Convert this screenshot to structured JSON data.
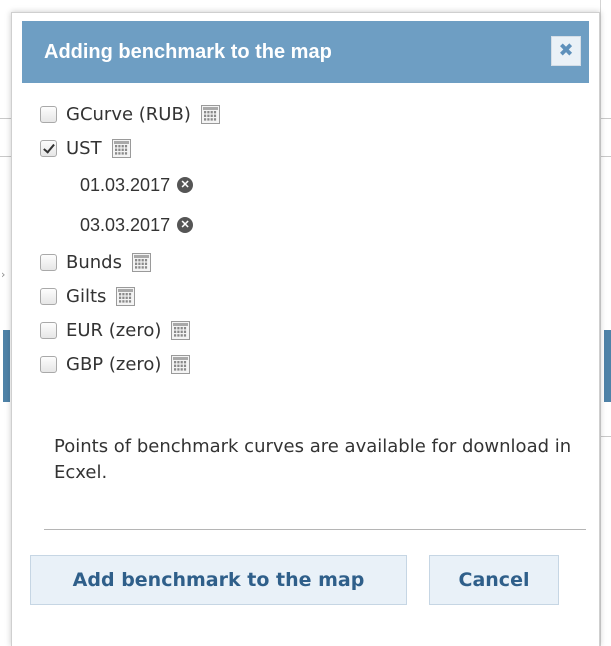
{
  "dialog": {
    "title": "Adding benchmark to the map",
    "close_symbol": "✖",
    "benchmarks": [
      {
        "label": "GCurve (RUB)",
        "checked": false
      },
      {
        "label": "UST",
        "checked": true,
        "dates": [
          "01.03.2017",
          "03.03.2017"
        ]
      },
      {
        "label": "Bunds",
        "checked": false
      },
      {
        "label": "Gilts",
        "checked": false
      },
      {
        "label": "EUR (zero)",
        "checked": false
      },
      {
        "label": "GBP (zero)",
        "checked": false
      }
    ],
    "note": "Points of benchmark curves are available for download in Ecxel.",
    "add_button_label": "Add benchmark to the map",
    "cancel_button_label": "Cancel"
  },
  "icons": {
    "close": "close-icon",
    "calendar": "calendar-icon",
    "remove_date": "remove-date-icon"
  },
  "colors": {
    "titlebar": "#6e9ec3",
    "button_bg": "#e9f1f8",
    "button_text": "#2f5f8a"
  }
}
